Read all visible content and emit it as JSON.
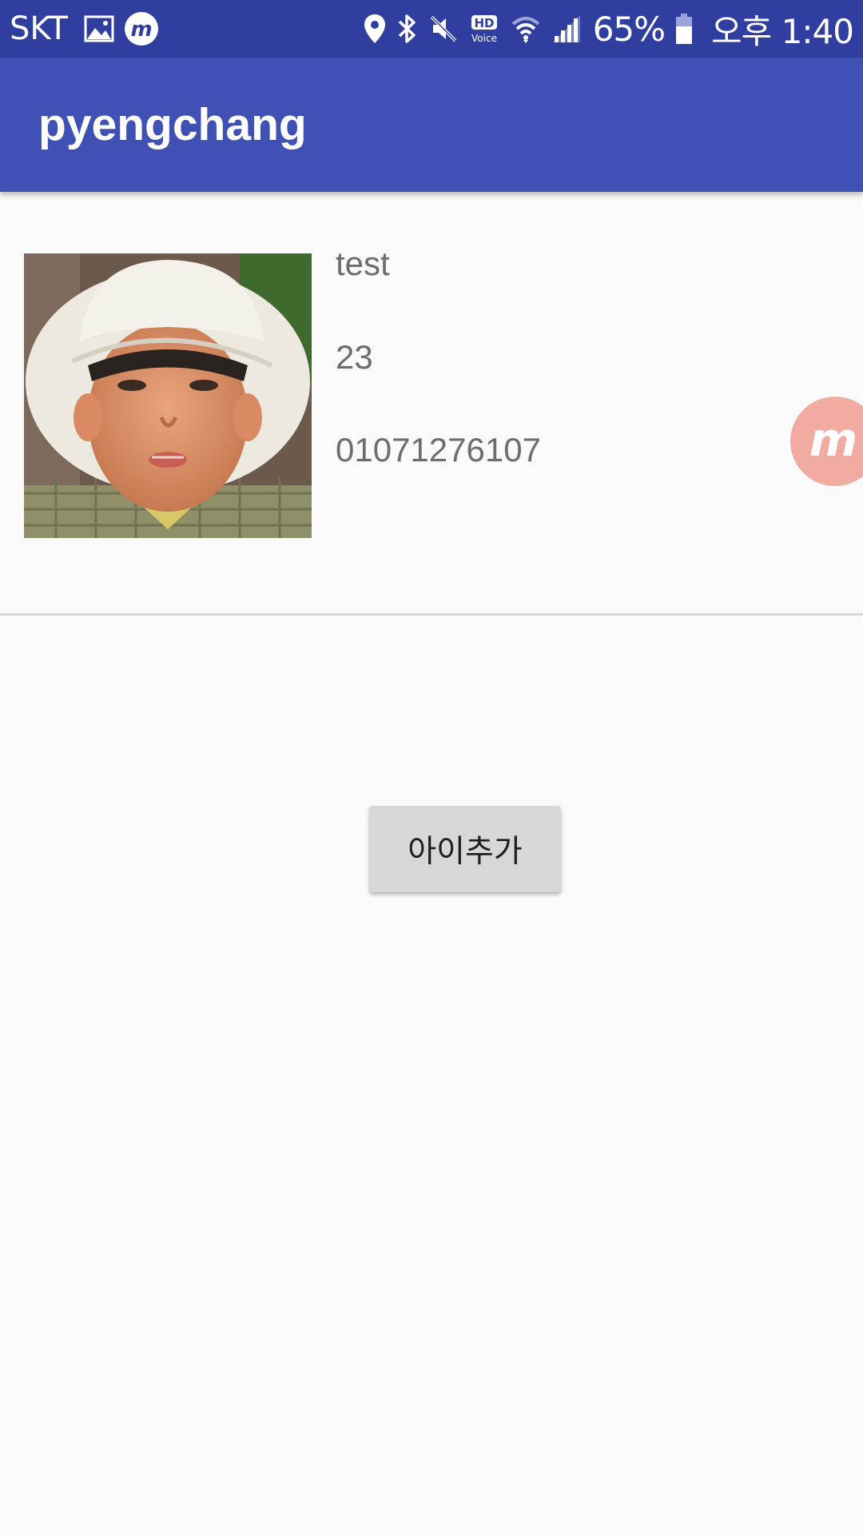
{
  "status_bar": {
    "carrier": "SKT",
    "battery_percent": "65%",
    "time": "오후 1:40",
    "icons": [
      "gallery-icon",
      "mobizen-icon",
      "location-icon",
      "bluetooth-icon",
      "mute-icon",
      "hd-voice-icon",
      "wifi-icon",
      "signal-icon",
      "battery-icon"
    ],
    "hd_label": "HD",
    "voice_label": "Voice"
  },
  "app_bar": {
    "title": "pyengchang"
  },
  "child": {
    "name": "test",
    "age": "23",
    "phone": "01071276107"
  },
  "floating_bubble": {
    "icon": "mobizen-floating-icon",
    "letter": "m"
  },
  "actions": {
    "add_child_label": "아이추가"
  },
  "colors": {
    "status_bar": "#303f9f",
    "app_bar": "#3f51b5",
    "background": "#fafafa",
    "button": "#d6d7d7",
    "text_secondary": "#6d6d6d",
    "bubble": "#f2a59a"
  }
}
